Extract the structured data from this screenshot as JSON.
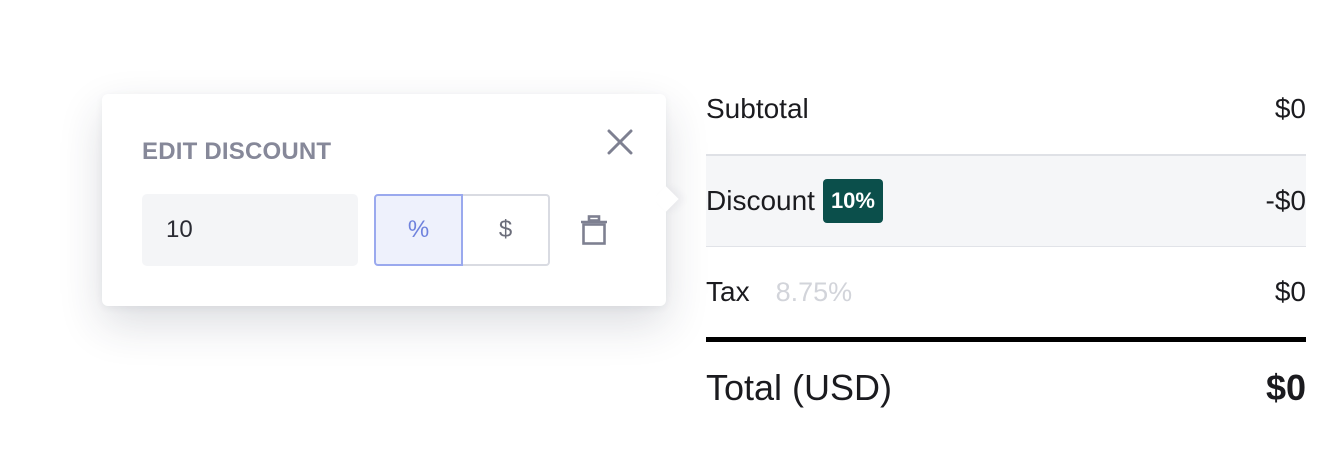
{
  "popover": {
    "title": "EDIT DISCOUNT",
    "input_value": "10",
    "toggle": {
      "percent_label": "%",
      "dollar_label": "$",
      "selected": "percent"
    },
    "icons": {
      "close": "close-icon",
      "delete": "trash-icon"
    }
  },
  "summary": {
    "subtotal_label": "Subtotal",
    "subtotal_value": "$0",
    "discount_label": "Discount",
    "discount_badge": "10%",
    "discount_value": "-$0",
    "tax_label": "Tax",
    "tax_rate": "8.75%",
    "tax_value": "$0",
    "total_label": "Total (USD)",
    "total_value": "$0"
  },
  "colors": {
    "badge_bg": "#0b4f4b",
    "toggle_active_border": "#9aa9ee",
    "toggle_active_bg": "#eef1fc",
    "title_gray": "#868899"
  }
}
